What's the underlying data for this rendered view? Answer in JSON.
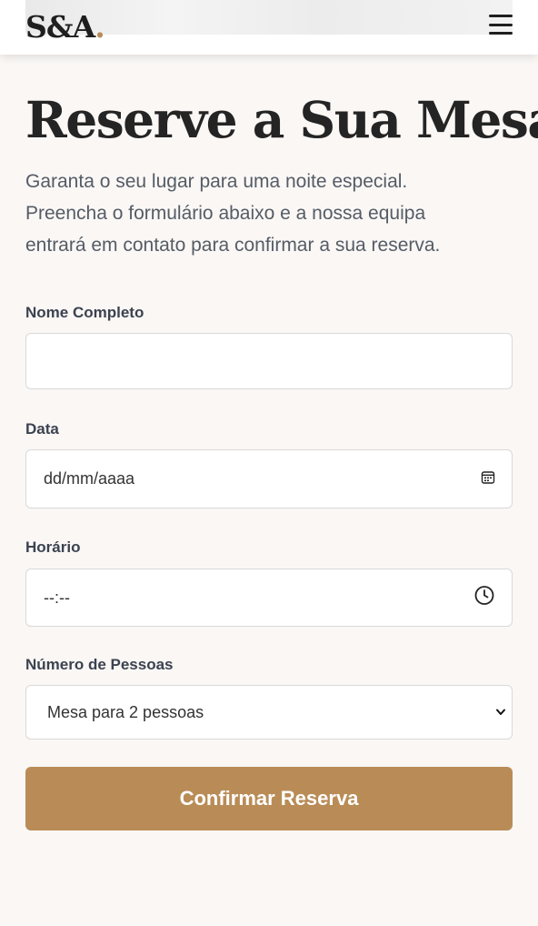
{
  "header": {
    "logo_text": "S&A",
    "logo_dot": ".",
    "menu_icon": "hamburger-menu-icon"
  },
  "main": {
    "title": "Reserve a Sua Mesa",
    "intro_lines": [
      "Garanta o seu lugar para uma noite especial.",
      "Preencha o formulário abaixo e a nossa equipa",
      "entrará em contato para confirmar a sua reserva."
    ]
  },
  "form": {
    "name": {
      "label": "Nome Completo",
      "value": ""
    },
    "date": {
      "label": "Data",
      "placeholder": "dd/mm/aaaa",
      "icon": "calendar-icon"
    },
    "time": {
      "label": "Horário",
      "placeholder": "--:--",
      "icon": "clock-icon"
    },
    "people": {
      "label": "Número de Pessoas",
      "selected": "Mesa para 2 pessoas",
      "icon": "chevron-down-icon"
    },
    "submit_label": "Confirmar Reserva"
  },
  "colors": {
    "accent": "#b98c57",
    "background": "#faf7f5",
    "heading": "#242424",
    "body_text": "#555c66"
  }
}
